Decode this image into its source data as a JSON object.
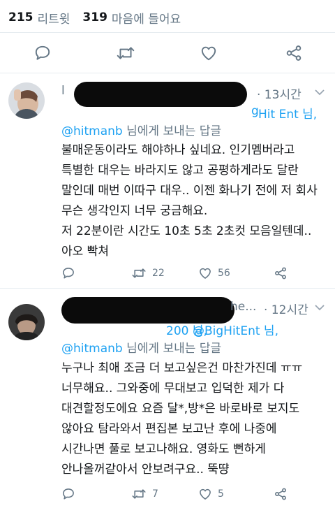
{
  "stats": {
    "retweets_count": "215",
    "retweets_label": "리트윗",
    "likes_count": "319",
    "likes_label": "마음에 들어요"
  },
  "tweets": [
    {
      "name_fragment": "l",
      "time": "· 13시간",
      "mention_partial": "g",
      "mention_bighit": "Hit Ent 님,",
      "mention_hitmanb": "@hitmanb",
      "mention_hitmanb_suffix": "님에게 보내는 답글",
      "body": "불매운동이라도 해야하나 싶네요. 인기멤버라고\n특별한 대우는 바라지도 않고 공평하게라도 달란\n말인데 매번 이따구 대우.. 이젠 화나기 전에 저 회사\n무슨 생각인지 너무 궁금해요.\n저 22분이란 시간도 10초 5초 2초컷 모음일텐데..\n아오 빡쳐",
      "retweet_count": "22",
      "like_count": "56"
    },
    {
      "name_fragment": "he...",
      "time": "· 12시간",
      "mention_partial": "200 님,",
      "mention_bighit": "@BigHitEnt 님,",
      "mention_hitmanb": "@hitmanb",
      "mention_hitmanb_suffix": "님에게 보내는 답글",
      "body": "누구나 최애 조금 더 보고싶은건 마찬가진데 ㅠㅠ\n너무해요.. 그와중에 무대보고 입덕한 제가 다\n대견할정도에요 요즘 달*,방*은 바로바로 보지도\n않아요 탐라와서 편집본 보고난 후에 나중에\n시간나면 풀로 보고나해요. 영화도 뻔하게\n안나올꺼같아서 안보려구요.. 뚝땽",
      "retweet_count": "7",
      "like_count": "5"
    }
  ],
  "icons": {
    "reply": "reply-icon",
    "retweet": "retweet-icon",
    "like": "heart-icon",
    "share": "share-icon",
    "chevron": "chevron-down-icon"
  },
  "colors": {
    "link": "#1da1f2",
    "muted": "#657786",
    "redaction": "#0b0b0b"
  }
}
